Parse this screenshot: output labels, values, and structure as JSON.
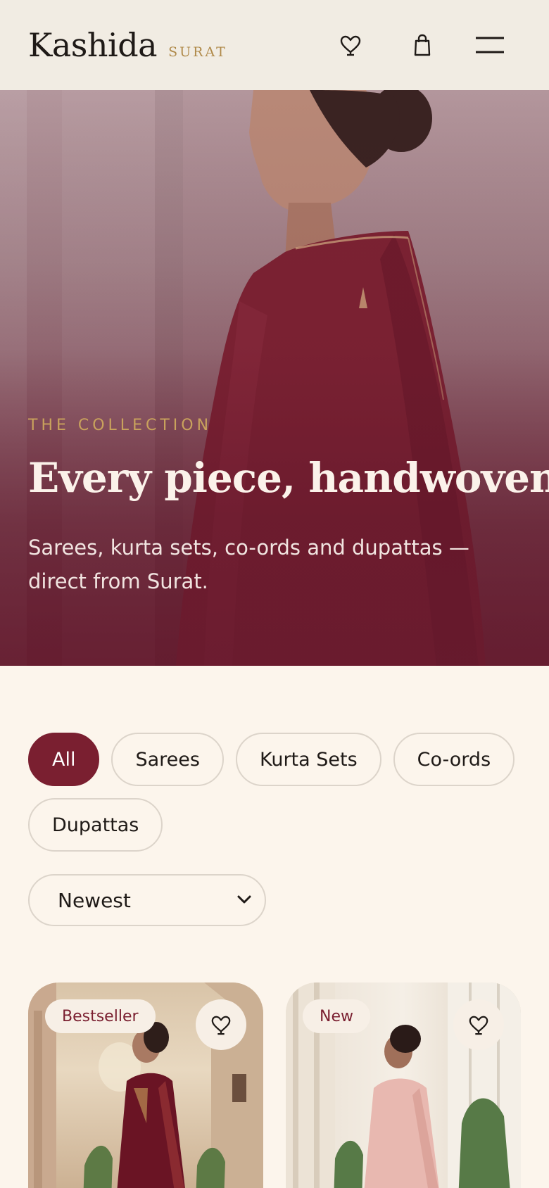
{
  "header": {
    "brand": "Kashida",
    "brand_suffix": "SURAT"
  },
  "icons": {
    "wishlist": "heart-icon",
    "bag": "shopping-bag-icon",
    "menu": "hamburger-menu-icon"
  },
  "hero": {
    "eyebrow": "THE COLLECTION",
    "title": "Every piece, handwoven",
    "subtitle": "Sarees, kurta sets, co-ords and dupattas — direct from Surat."
  },
  "filters": {
    "items": [
      {
        "label": "All",
        "active": true
      },
      {
        "label": "Sarees",
        "active": false
      },
      {
        "label": "Kurta Sets",
        "active": false
      },
      {
        "label": "Co-ords",
        "active": false
      },
      {
        "label": "Dupattas",
        "active": false
      }
    ]
  },
  "sort": {
    "selected": "Newest"
  },
  "products": [
    {
      "badge": "Bestseller"
    },
    {
      "badge": "New"
    }
  ],
  "colors": {
    "accent": "#7a1f30",
    "gold": "#b08a4a",
    "background": "#fcf5ec"
  }
}
